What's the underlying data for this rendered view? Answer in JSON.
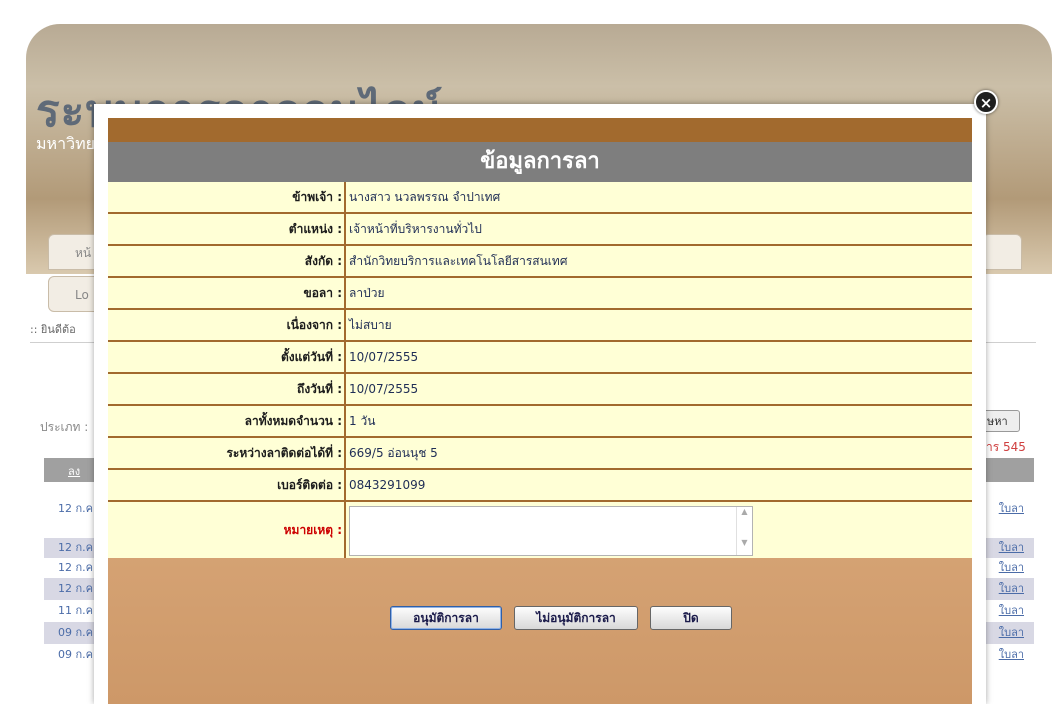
{
  "background": {
    "title": "ระบบการลาออนไลน์",
    "subtitle": "มหาวิทย",
    "tab_1": "หน้",
    "tab_2": "Lo",
    "welcome": ":: ยินดีต้อ",
    "type_label": "ประเภท :",
    "search_button": "ษหา",
    "count_text": "าร 545",
    "table_head": "ลง",
    "rows": [
      {
        "date": "12 ก.ค",
        "link": "ใบลา"
      },
      {
        "date": "12 ก.ค",
        "link": "ใบลา"
      },
      {
        "date": "12 ก.ค",
        "link": "ใบลา"
      },
      {
        "date": "12 ก.ค",
        "link": "ใบลา"
      },
      {
        "date": "11 ก.ค",
        "link": "ใบลา"
      },
      {
        "date": "09 ก.ค",
        "link": "ใบลา"
      },
      {
        "date": "09 ก.ค",
        "link": "ใบลา"
      }
    ]
  },
  "modal": {
    "close_icon": "close-circle-icon",
    "title": "ข้อมูลการลา",
    "fields": [
      {
        "label": "ข้าพเจ้า :",
        "value": "นางสาว นวลพรรณ จำปาเทศ"
      },
      {
        "label": "ตำแหน่ง :",
        "value": "เจ้าหน้าที่บริหารงานทั่วไป"
      },
      {
        "label": "สังกัด :",
        "value": "สำนักวิทยบริการและเทคโนโลยีสารสนเทศ"
      },
      {
        "label": "ขอลา :",
        "value": "ลาป่วย"
      },
      {
        "label": "เนื่องจาก :",
        "value": "ไม่สบาย"
      },
      {
        "label": "ตั้งแต่วันที่ :",
        "value": "10/07/2555"
      },
      {
        "label": "ถึงวันที่ :",
        "value": "10/07/2555"
      },
      {
        "label": "ลาทั้งหมดจำนวน :",
        "value": "1 วัน"
      },
      {
        "label": "ระหว่างลาติดต่อได้ที่ :",
        "value": "669/5 อ่อนนุช 5"
      },
      {
        "label": "เบอร์ติดต่อ :",
        "value": "0843291099"
      }
    ],
    "note_label": "หมายเหตุ :",
    "note_value": "",
    "buttons": {
      "approve": "อนุมัติการลา",
      "reject": "ไม่อนุมัติการลา",
      "close": "ปิด"
    }
  }
}
